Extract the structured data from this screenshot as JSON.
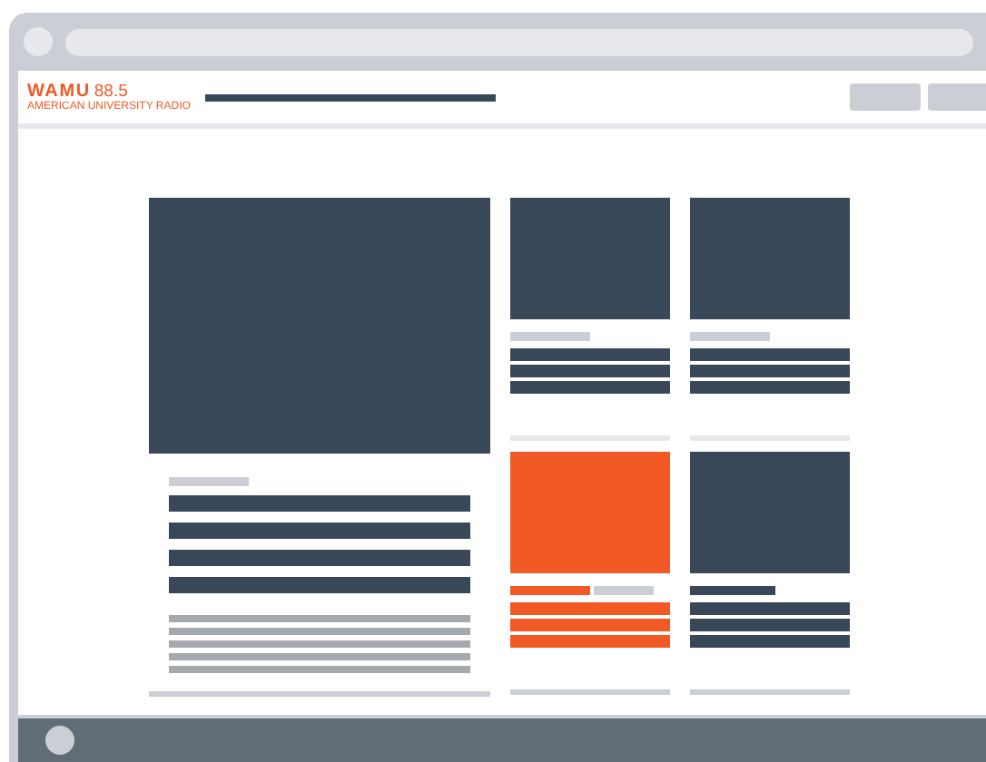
{
  "logo": {
    "name": "WAMU",
    "frequency": "88.5",
    "tagline": "AMERICAN UNIVERSITY RADIO"
  },
  "cards": [
    {
      "kind": "standard",
      "color": "#394859"
    },
    {
      "kind": "standard",
      "color": "#394859"
    },
    {
      "kind": "highlight",
      "color": "#f15a24"
    },
    {
      "kind": "labelled",
      "color": "#394859"
    }
  ]
}
